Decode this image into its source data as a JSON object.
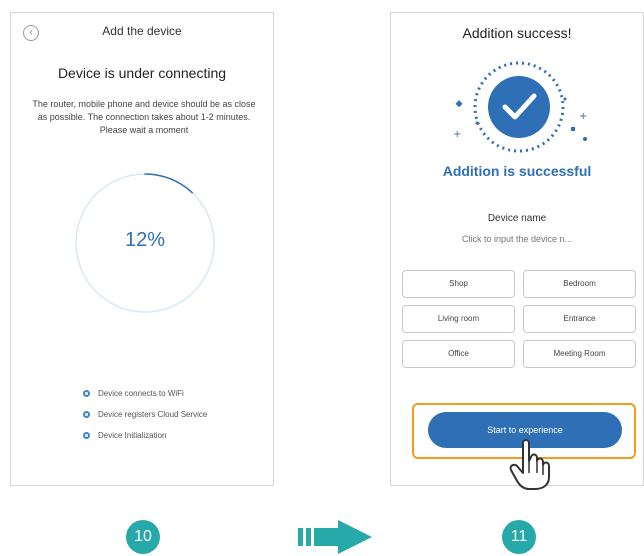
{
  "left_screen": {
    "header_title": "Add the device",
    "heading": "Device is under connecting",
    "description": "The router, mobile phone and device should be as close as possible. The connection takes about 1-2 minutes. Please wait a moment",
    "progress_text": "12%",
    "progress_fraction": 0.12,
    "steps": [
      "Device connects to WiFi",
      "Device registers Cloud Service",
      "Device Initialization"
    ],
    "back_icon": "chevron-left-icon"
  },
  "right_screen": {
    "title": "Addition success!",
    "success_message": "Addition is successful",
    "device_name_label": "Device name",
    "device_name_placeholder": "Click to input the device n...",
    "rooms": [
      "Shop",
      "Bedroom",
      "Living room",
      "Entrance",
      "Office",
      "Meeting Room"
    ],
    "cta_label": "Start to experience",
    "check_icon": "checkmark-icon",
    "hand_icon": "pointer-hand-icon"
  },
  "step_numbers": [
    "10",
    "11"
  ],
  "colors": {
    "primary_blue": "#2e6fb5",
    "accent_orange": "#f39b1e",
    "teal": "#27a9a9"
  }
}
